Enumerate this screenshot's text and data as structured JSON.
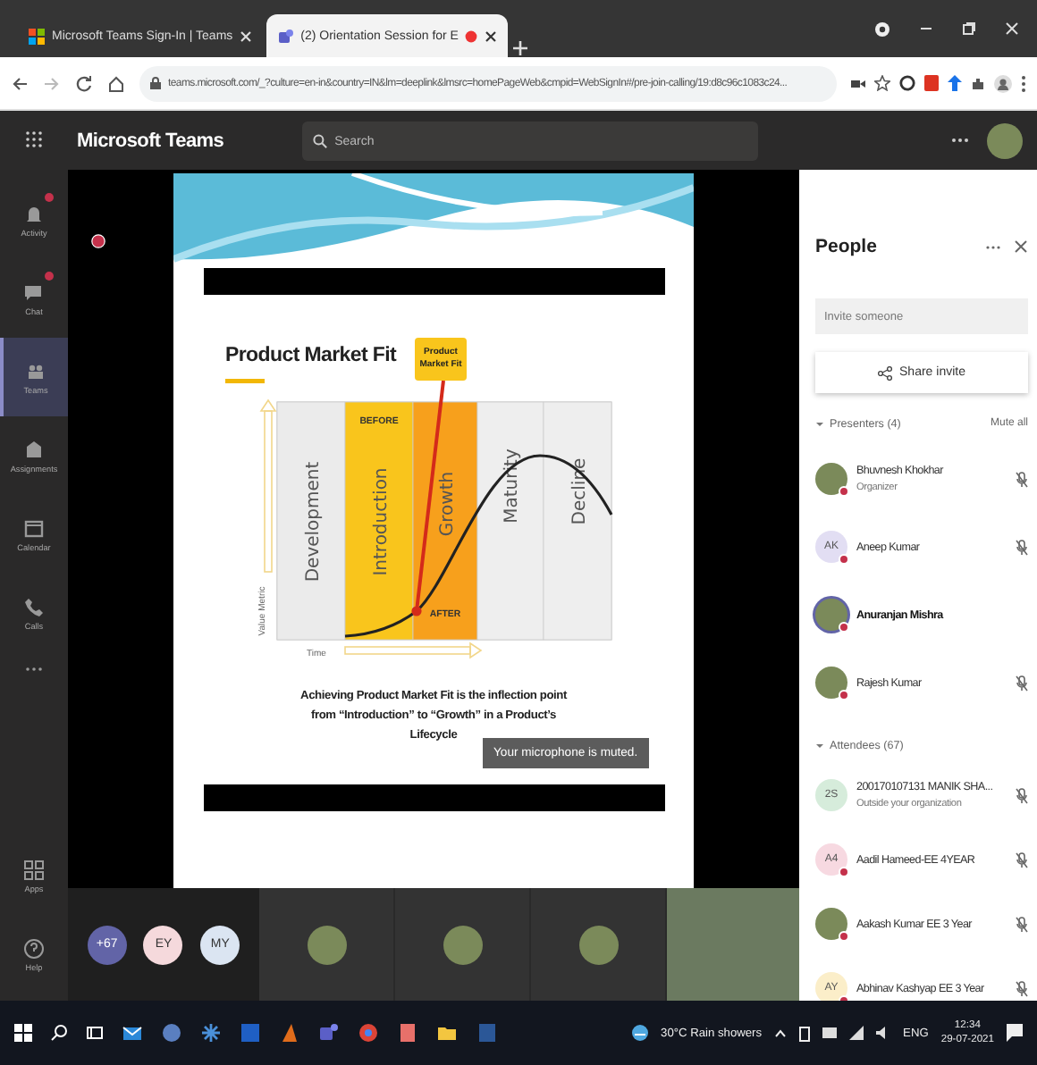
{
  "browser": {
    "tabs": [
      {
        "title": "Microsoft Teams Sign-In | Teams",
        "selected": false,
        "recording": false
      },
      {
        "title": "(2) Orientation Session for E",
        "selected": true,
        "recording": true
      }
    ],
    "url": "teams.microsoft.com/_?culture=en-in&country=IN&lm=deeplink&lmsrc=homePageWeb&cmpid=WebSignIn#/pre-join-calling/19:d8c96c1083c24..."
  },
  "app": {
    "title": "Microsoft Teams",
    "search_placeholder": "Search"
  },
  "rail": {
    "top": [
      {
        "label": "Activity",
        "selected": false,
        "badge": true
      },
      {
        "label": "Chat",
        "selected": false,
        "badge": true
      },
      {
        "label": "Teams",
        "selected": true,
        "badge": false
      },
      {
        "label": "Assignments",
        "selected": false,
        "badge": false
      },
      {
        "label": "Calendar",
        "selected": false,
        "badge": false
      },
      {
        "label": "Calls",
        "selected": false,
        "badge": false
      }
    ],
    "bottom": [
      {
        "label": "Apps",
        "selected": false,
        "badge": false
      },
      {
        "label": "Help",
        "selected": false,
        "badge": false
      }
    ]
  },
  "slide": {
    "title": "Product Market Fit",
    "callout": [
      "Product",
      "Market Fit"
    ],
    "stages": [
      {
        "label": "Development",
        "color": "#ebebeb"
      },
      {
        "label": "Introduction",
        "color": "#f9c51c"
      },
      {
        "label": "Growth",
        "color": "#f7a01c"
      },
      {
        "label": "Maturity",
        "color": "#eeeeee"
      },
      {
        "label": "Decline",
        "color": "#eeeeee"
      }
    ],
    "before_label": "BEFORE",
    "after_label": "AFTER",
    "y_axis": "Value Metric",
    "x_axis": "Time",
    "caption": "Achieving Product Market Fit is the inflection point from “Introduction” to “Growth” in a Product’s Lifecycle"
  },
  "toast": "Your microphone is muted.",
  "strip": {
    "people": [
      {
        "kind": "count",
        "label": "+67",
        "color": "#6264a7"
      },
      {
        "kind": "initials",
        "label": "EY",
        "color": "#f5d9dc"
      },
      {
        "kind": "initials",
        "label": "MY",
        "color": "#dbe5f2"
      }
    ],
    "tiles": [
      {
        "kind": "photo"
      },
      {
        "kind": "photo"
      },
      {
        "kind": "photo"
      },
      {
        "kind": "video"
      }
    ]
  },
  "people": {
    "title": "People",
    "invite_placeholder": "Invite someone",
    "share_button": "Share invite",
    "sections": [
      {
        "title": "Presenters (4)",
        "action": "Mute all",
        "members": [
          {
            "name": "Bhuvnesh Khokhar",
            "subtitle": "Organizer",
            "status_dot": true,
            "muted": true,
            "speaking": false
          },
          {
            "name": "Aneep Kumar",
            "initials": "AK",
            "color": "#e2def3",
            "status_dot": true,
            "muted": true,
            "speaking": false
          },
          {
            "name": "Anuranjan Mishra",
            "status_dot": true,
            "muted": false,
            "speaking": true
          },
          {
            "name": "Rajesh Kumar",
            "status_dot": true,
            "muted": true,
            "speaking": false
          }
        ]
      },
      {
        "title": "Attendees (67)",
        "members": [
          {
            "name": "200170107131 MANIK SHA...",
            "subtitle": "Outside your organization",
            "initials": "2S",
            "color": "#d6ecdb",
            "status_dot": false,
            "muted": true,
            "speaking": false
          },
          {
            "name": "Aadil Hameed-EE 4YEAR",
            "initials": "A4",
            "color": "#f7d9e1",
            "status_dot": true,
            "muted": true,
            "speaking": false
          },
          {
            "name": "Aakash Kumar EE 3 Year",
            "status_dot": true,
            "muted": true,
            "speaking": false
          },
          {
            "name": "Abhinav Kashyap EE 3 Year",
            "initials": "AY",
            "color": "#fbeec9",
            "status_dot": true,
            "muted": true,
            "speaking": false
          }
        ]
      }
    ]
  },
  "taskbar": {
    "weather": "30°C  Rain showers",
    "language": "ENG",
    "time": "12:34",
    "date": "29-07-2021"
  }
}
